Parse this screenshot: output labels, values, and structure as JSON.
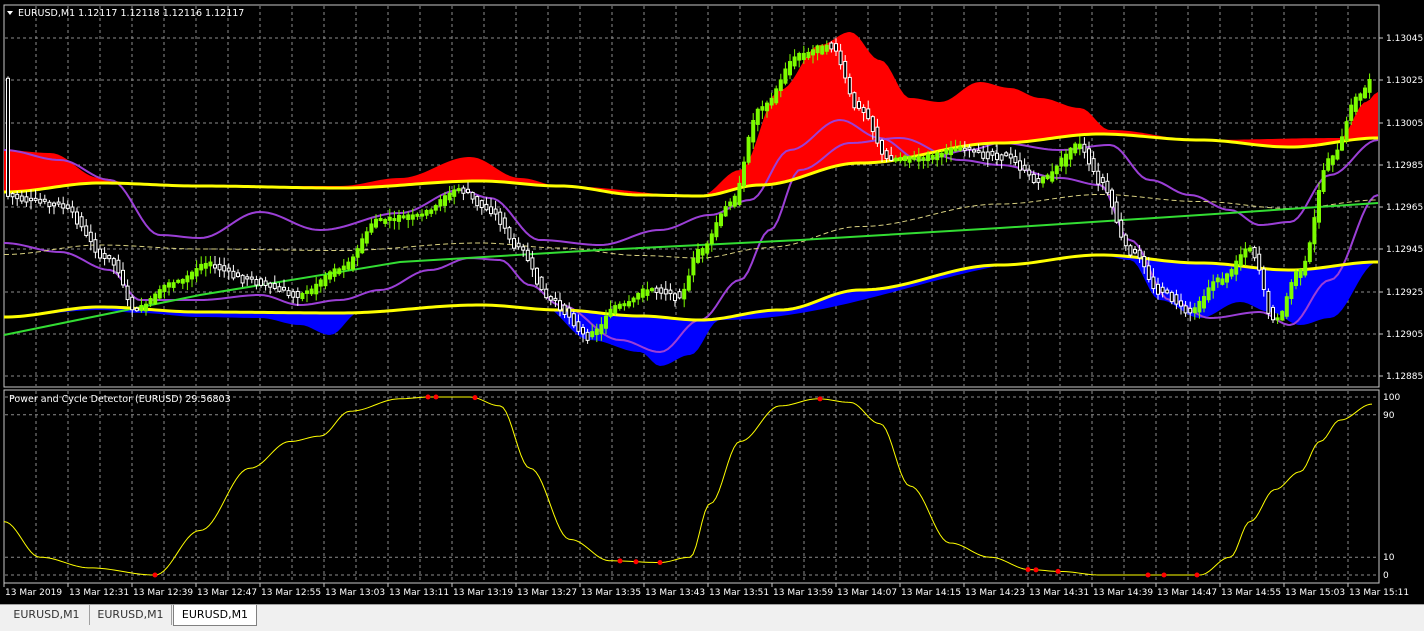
{
  "main_chart": {
    "header": "EURUSD,M1  1.12117 1.12118 1.12116 1.12117",
    "price_axis_labels": [
      "1.13045",
      "1.13025",
      "1.13005",
      "1.12985",
      "1.12965",
      "1.12945",
      "1.12925",
      "1.12905",
      "1.12885"
    ]
  },
  "indicator": {
    "header": "Power and Cycle Detector (EURUSD) 29.56803",
    "axis_labels": [
      "100",
      "90",
      "10",
      "0"
    ],
    "level_values": [
      100,
      90,
      10,
      0
    ]
  },
  "time_axis_labels": [
    "13 Mar 2019",
    "13 Mar 12:31",
    "13 Mar 12:39",
    "13 Mar 12:47",
    "13 Mar 12:55",
    "13 Mar 13:03",
    "13 Mar 13:11",
    "13 Mar 13:19",
    "13 Mar 13:27",
    "13 Mar 13:35",
    "13 Mar 13:43",
    "13 Mar 13:51",
    "13 Mar 13:59",
    "13 Mar 14:07",
    "13 Mar 14:15",
    "13 Mar 14:23",
    "13 Mar 14:31",
    "13 Mar 14:39",
    "13 Mar 14:47",
    "13 Mar 14:55",
    "13 Mar 15:03",
    "13 Mar 15:11"
  ],
  "tabs": [
    {
      "label": "EURUSD,M1",
      "active": false
    },
    {
      "label": "EURUSD,M1",
      "active": false
    },
    {
      "label": "EURUSD,M1",
      "active": true
    }
  ],
  "colors": {
    "background": "#000000",
    "grid": "#8c8c8c",
    "bull_candle": "#7cfc00",
    "bear_candle": "#ffffff",
    "upper_cloud": "#ff0000",
    "lower_cloud": "#0000ff",
    "band_yellow": "#ffff00",
    "envelope_purple": "#9b3fd6",
    "trend_green": "#33dd33",
    "cycle_line": "#ffff00",
    "cycle_marker": "#ff0000"
  }
}
